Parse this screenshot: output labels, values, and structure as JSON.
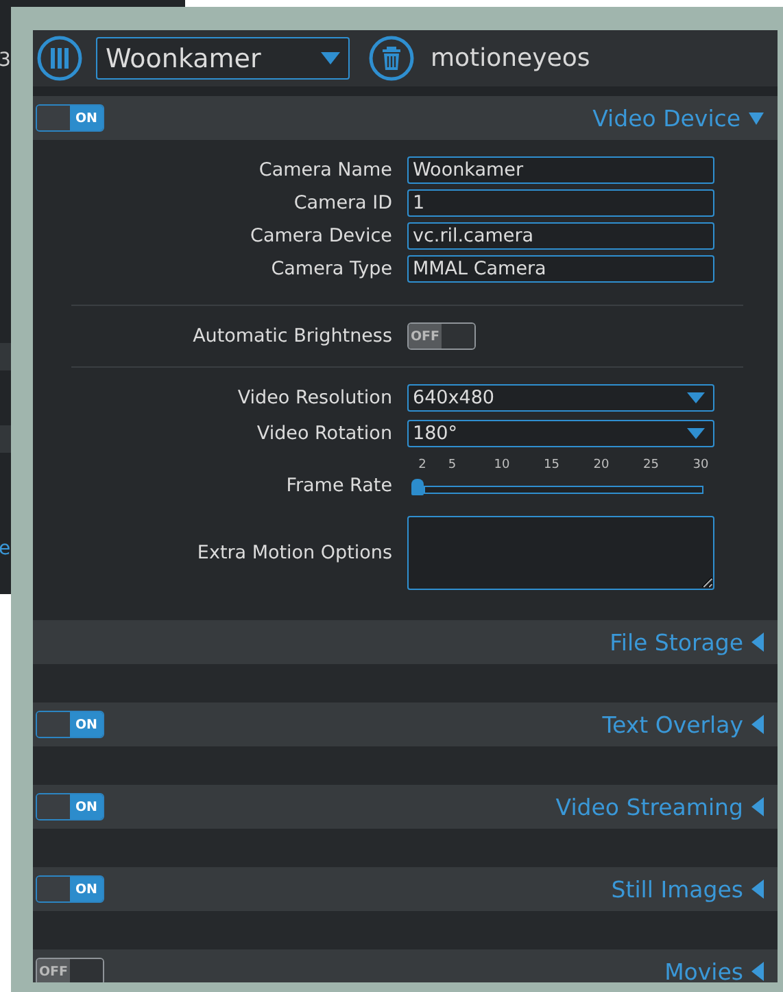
{
  "background_window": {
    "texts": [
      {
        "text": "3",
        "kind": "plain"
      },
      {
        "text": "e",
        "kind": "link"
      }
    ]
  },
  "header": {
    "camera_select": {
      "value": "Woonkamer"
    },
    "title": "motioneyeos"
  },
  "sections": [
    {
      "title": "Video Device",
      "kind": "toggle",
      "on": true,
      "toggle_text": "ON",
      "expanded": true,
      "fields": [
        {
          "kind": "text",
          "label": "Camera Name",
          "value": "Woonkamer"
        },
        {
          "kind": "text",
          "label": "Camera ID",
          "value": "1"
        },
        {
          "kind": "text",
          "label": "Camera Device",
          "value": "vc.ril.camera"
        },
        {
          "kind": "text",
          "label": "Camera Type",
          "value": "MMAL Camera"
        },
        {
          "kind": "divider"
        },
        {
          "kind": "toggle",
          "label": "Automatic Brightness",
          "on": false,
          "toggle_text": "OFF"
        },
        {
          "kind": "divider"
        },
        {
          "kind": "select",
          "label": "Video Resolution",
          "value": "640x480"
        },
        {
          "kind": "select",
          "label": "Video Rotation",
          "value": "180°"
        },
        {
          "kind": "slider",
          "label": "Frame Rate",
          "ticks": [
            "2",
            "5",
            "10",
            "15",
            "20",
            "25",
            "30"
          ],
          "level": 0
        },
        {
          "kind": "textarea",
          "label": "Extra Motion Options"
        }
      ]
    },
    {
      "title": "File Storage",
      "kind": "plain",
      "expanded": false
    },
    {
      "title": "Text Overlay",
      "kind": "toggle",
      "on": true,
      "toggle_text": "ON",
      "expanded": false
    },
    {
      "title": "Video Streaming",
      "kind": "toggle",
      "on": true,
      "toggle_text": "ON",
      "expanded": false
    },
    {
      "title": "Still Images",
      "kind": "toggle",
      "on": true,
      "toggle_text": "ON",
      "expanded": false
    },
    {
      "title": "Movies",
      "kind": "toggle",
      "on": false,
      "toggle_text": "OFF",
      "expanded": false
    }
  ]
}
